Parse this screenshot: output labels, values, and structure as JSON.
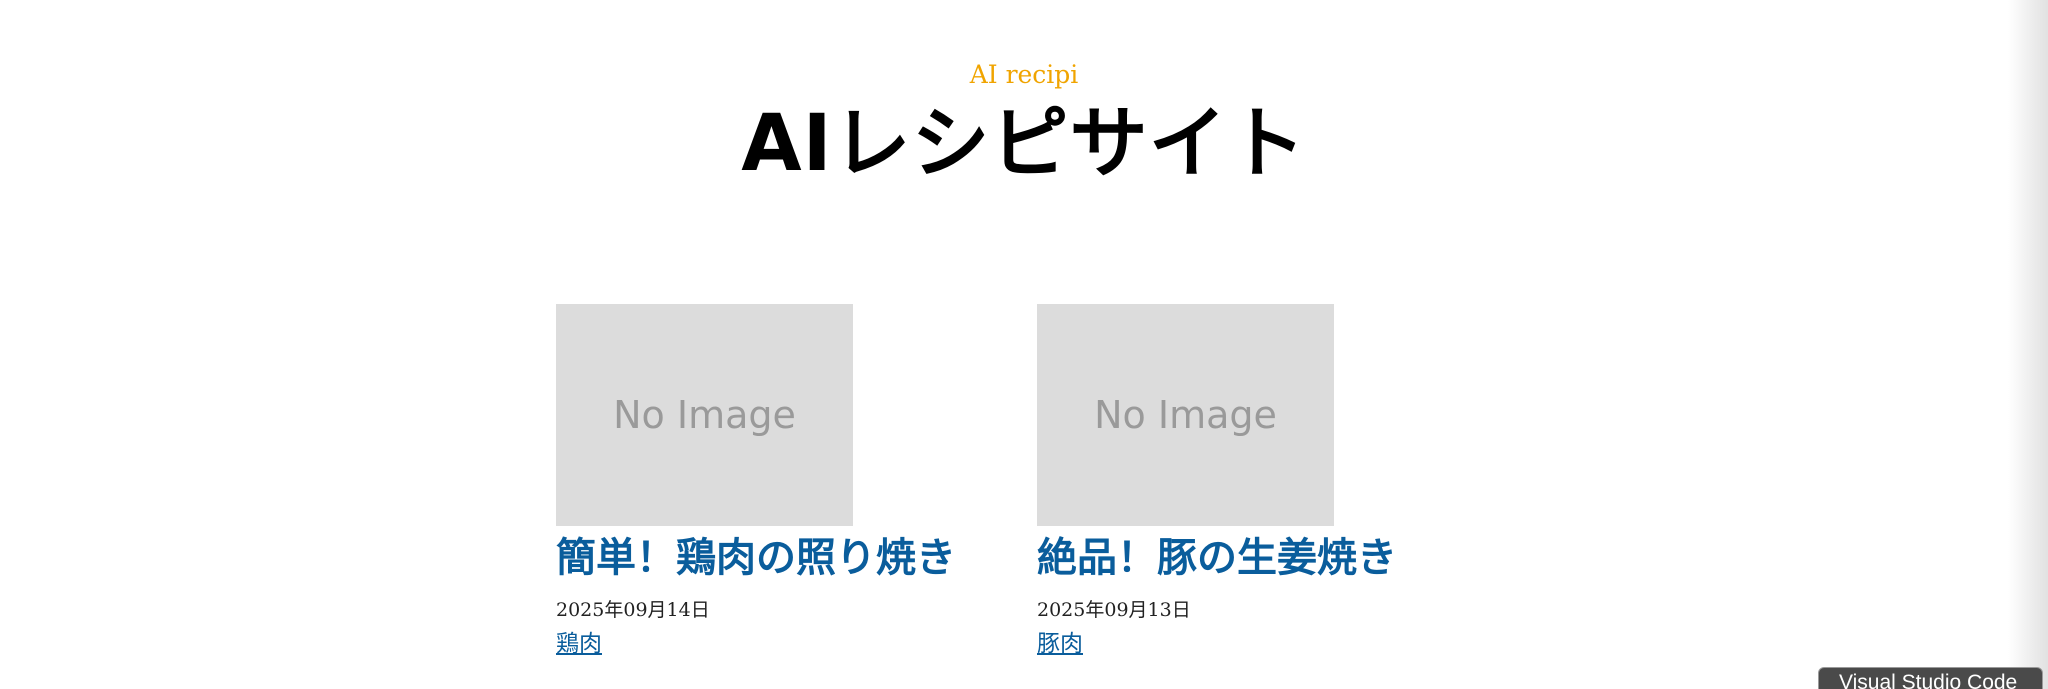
{
  "site": {
    "subtitle": "AI recipi",
    "title": "AIレシピサイト"
  },
  "posts": [
    {
      "thumbnail_text": "No Image",
      "title": "簡単！鶏肉の照り焼き",
      "date": "2025年09月14日",
      "tag": "鶏肉"
    },
    {
      "thumbnail_text": "No Image",
      "title": "絶品！豚の生姜焼き",
      "date": "2025年09月13日",
      "tag": "豚肉"
    }
  ],
  "taskbar": {
    "tooltip": "Visual Studio Code"
  },
  "colors": {
    "accent": "#f0a400",
    "link": "#0a5d9c",
    "placeholder_bg": "#dcdcdc"
  }
}
